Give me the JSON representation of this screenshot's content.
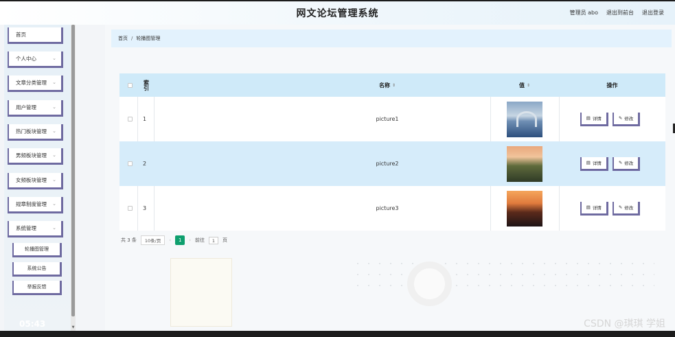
{
  "app": {
    "title": "网文论坛管理系统",
    "admin_label": "管理员 abo",
    "front_link": "退出到前台",
    "logout_link": "退出登录"
  },
  "sidebar": {
    "items": [
      {
        "label": "首页",
        "has_children": false
      },
      {
        "label": "个人中心",
        "has_children": true
      },
      {
        "label": "文章分类管理",
        "has_children": true
      },
      {
        "label": "用户管理",
        "has_children": true
      },
      {
        "label": "热门板块管理",
        "has_children": true
      },
      {
        "label": "男频板块管理",
        "has_children": true
      },
      {
        "label": "女频板块管理",
        "has_children": true
      },
      {
        "label": "规章制度管理",
        "has_children": true
      },
      {
        "label": "系统管理",
        "has_children": true
      }
    ],
    "sub_items": [
      "轮播图管理",
      "系统公告",
      "举报反馈"
    ]
  },
  "breadcrumb": {
    "home": "首页",
    "separator": "/",
    "current": "轮播图管理"
  },
  "table": {
    "columns": {
      "index": "索引",
      "name": "名称",
      "value": "值",
      "actions": "操作"
    },
    "rows": [
      {
        "index": "1",
        "name": "picture1",
        "image": "lake-bridge"
      },
      {
        "index": "2",
        "name": "picture2",
        "image": "castle-sunset"
      },
      {
        "index": "3",
        "name": "picture3",
        "image": "harbor-dusk"
      }
    ],
    "detail_label": "详情",
    "edit_label": "修改"
  },
  "pagination": {
    "total": "共 3 条",
    "page_size": "10条/页",
    "current_page": "1",
    "goto_label": "前往",
    "goto_value": "1",
    "page_suffix": "页"
  },
  "overlay": {
    "video_time": "05:43",
    "watermark": "CSDN @琪琪 学姐"
  },
  "colors": {
    "accent_border": "#6e6aa0",
    "header_bg": "#cfeaf9",
    "row_alt_bg": "#d6ecfa",
    "pager_active": "#0e9f6e"
  }
}
